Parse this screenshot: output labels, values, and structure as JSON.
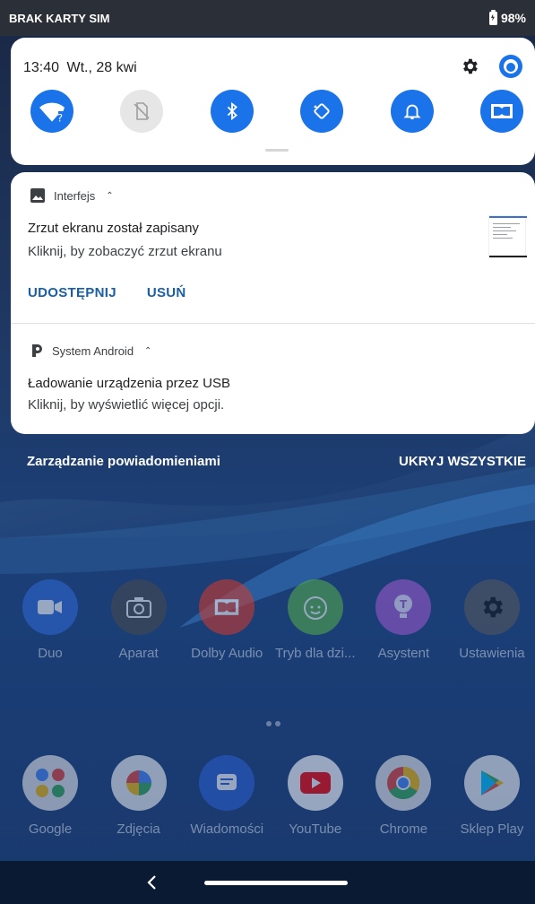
{
  "status_bar": {
    "carrier": "BRAK KARTY SIM",
    "battery": "98%"
  },
  "quick_settings": {
    "time": "13:40",
    "date": "Wt., 28 kwi",
    "tiles": [
      {
        "name": "wifi",
        "icon": "wifi-unknown-icon",
        "active": true
      },
      {
        "name": "sim",
        "icon": "no-sim-icon",
        "active": false
      },
      {
        "name": "bluetooth",
        "icon": "bluetooth-icon",
        "active": true
      },
      {
        "name": "autorotate",
        "icon": "autorotate-icon",
        "active": true
      },
      {
        "name": "notifications",
        "icon": "bell-icon",
        "active": true
      },
      {
        "name": "dolby",
        "icon": "dolby-icon",
        "active": true
      }
    ]
  },
  "notifications": [
    {
      "app": "Interfejs",
      "title": "Zrzut ekranu został zapisany",
      "text": "Kliknij, by zobaczyć zrzut ekranu",
      "actions": [
        "UDOSTĘPNIJ",
        "USUŃ"
      ]
    },
    {
      "app": "System Android",
      "title": "Ładowanie urządzenia przez USB",
      "text": "Kliknij, by wyświetlić więcej opcji."
    }
  ],
  "manage_label": "Zarządzanie powiadomieniami",
  "hide_all_label": "UKRYJ WSZYSTKIE",
  "home_row_1": [
    {
      "label": "Duo",
      "icon": "duo-icon",
      "color": "#2f6bd8"
    },
    {
      "label": "Aparat",
      "icon": "camera-icon",
      "color": "#4a4a4a"
    },
    {
      "label": "Dolby Audio",
      "icon": "dolby-icon",
      "color": "#d83a2a"
    },
    {
      "label": "Tryb dla dzi...",
      "icon": "kids-icon",
      "color": "#56b04a"
    },
    {
      "label": "Asystent",
      "icon": "lightbulb-icon",
      "color": "#a35ad0"
    },
    {
      "label": "Ustawienia",
      "icon": "gear-icon",
      "color": "#5a5a5a"
    }
  ],
  "home_row_2": [
    {
      "label": "Google",
      "icon": "google-folder-icon",
      "color": "#e8e8e8"
    },
    {
      "label": "Zdjęcia",
      "icon": "photos-icon",
      "color": "#f3f3f3"
    },
    {
      "label": "Wiadomości",
      "icon": "messages-icon",
      "color": "#2a5fd0"
    },
    {
      "label": "YouTube",
      "icon": "youtube-icon",
      "color": "#ffffff"
    },
    {
      "label": "Chrome",
      "icon": "chrome-icon",
      "color": "#e8e8e8"
    },
    {
      "label": "Sklep Play",
      "icon": "play-store-icon",
      "color": "#f3f3f3"
    }
  ]
}
